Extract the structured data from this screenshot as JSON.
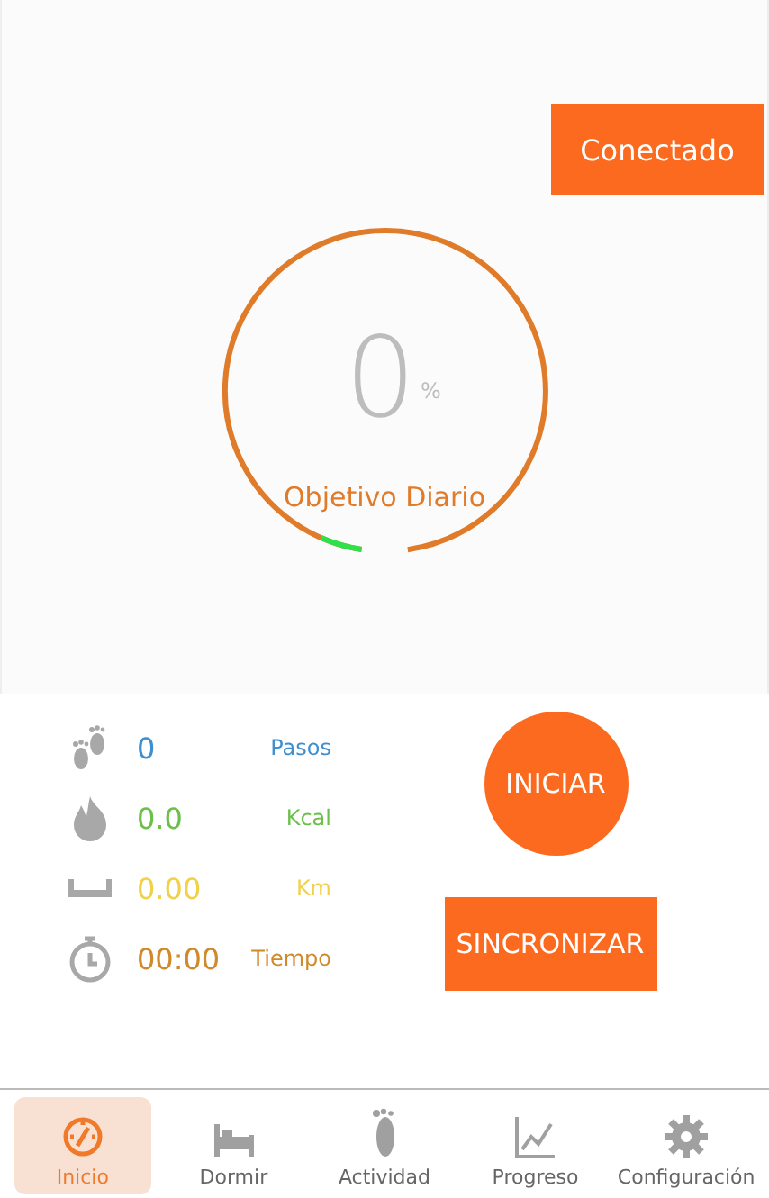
{
  "status_button": {
    "label": "Conectado"
  },
  "goal": {
    "value": "0",
    "unit": "%",
    "label": "Objetivo Diario"
  },
  "stats": [
    {
      "kind": "steps",
      "value": "0",
      "label": "Pasos",
      "color": "#3d8fd0"
    },
    {
      "kind": "calories",
      "value": "0.0",
      "label": "Kcal",
      "color": "#6cc04a"
    },
    {
      "kind": "distance",
      "value": "0.00",
      "label": "Km",
      "color": "#f0d24a"
    },
    {
      "kind": "time",
      "value": "00:00",
      "label": "Tiempo",
      "color": "#d08a2a"
    }
  ],
  "start_button": {
    "label": "INICIAR"
  },
  "sync_button": {
    "label": "SINCRONIZAR"
  },
  "nav": [
    {
      "kind": "home",
      "label": "Inicio",
      "selected": true
    },
    {
      "kind": "sleep",
      "label": "Dormir",
      "selected": false
    },
    {
      "kind": "activity",
      "label": "Actividad",
      "selected": false
    },
    {
      "kind": "progress",
      "label": "Progreso",
      "selected": false
    },
    {
      "kind": "settings",
      "label": "Configuración",
      "selected": false
    }
  ]
}
